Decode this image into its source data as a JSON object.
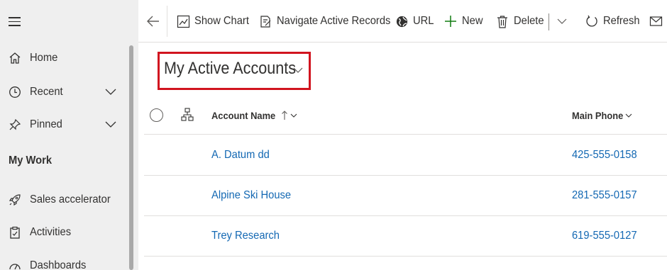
{
  "sidebar": {
    "items": [
      {
        "label": "Home",
        "icon": "home-icon"
      },
      {
        "label": "Recent",
        "icon": "clock-icon",
        "expandable": true
      },
      {
        "label": "Pinned",
        "icon": "pin-icon",
        "expandable": true
      }
    ],
    "section_title": "My Work",
    "work_items": [
      {
        "label": "Sales accelerator",
        "icon": "rocket-icon"
      },
      {
        "label": "Activities",
        "icon": "clipboard-icon"
      },
      {
        "label": "Dashboards",
        "icon": "dashboard-icon"
      }
    ]
  },
  "commandbar": {
    "show_chart": "Show Chart",
    "navigate_active_records": "Navigate Active Records",
    "url": "URL",
    "new": "New",
    "delete": "Delete",
    "refresh": "Refresh"
  },
  "view": {
    "title": "My Active Accounts"
  },
  "grid": {
    "columns": {
      "account_name": "Account Name",
      "main_phone": "Main Phone"
    },
    "sort": "ascending",
    "rows": [
      {
        "name": "A. Datum dd",
        "phone": "425-555-0158"
      },
      {
        "name": "Alpine Ski House",
        "phone": "281-555-0157"
      },
      {
        "name": "Trey Research",
        "phone": "619-555-0127"
      }
    ]
  },
  "colors": {
    "accent_link": "#1368b3",
    "highlight_box": "#d1141f",
    "new_icon": "#107c10"
  }
}
